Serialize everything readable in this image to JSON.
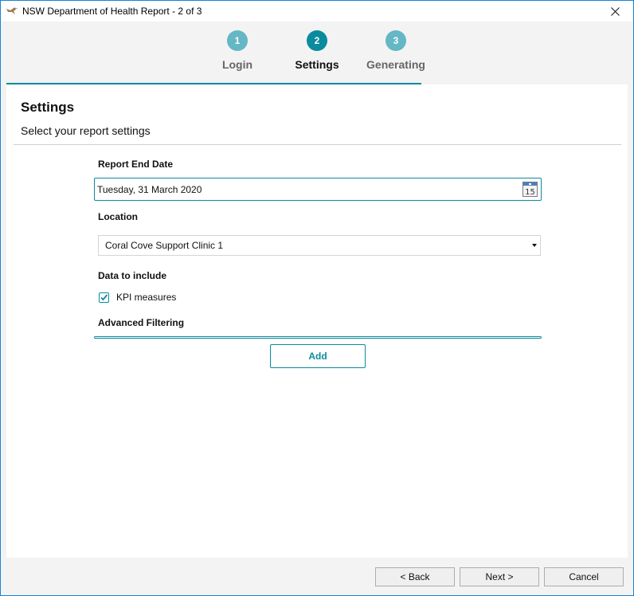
{
  "window": {
    "title": "NSW Department of Health Report - 2 of 3",
    "close_icon": "close-icon",
    "app_icon": "bird-logo-icon"
  },
  "stepper": {
    "steps": [
      {
        "number": "1",
        "label": "Login",
        "state": "done",
        "color": "#64b7c5"
      },
      {
        "number": "2",
        "label": "Settings",
        "state": "active",
        "color": "#0a8b9e"
      },
      {
        "number": "3",
        "label": "Generating",
        "state": "pending",
        "color": "#64b7c5"
      }
    ],
    "progress_color": "#0a8b9e"
  },
  "page": {
    "title": "Settings",
    "subtitle": "Select your report settings"
  },
  "form": {
    "report_end_date": {
      "label": "Report End Date",
      "value": "Tuesday, 31 March 2020",
      "icon": "calendar-icon",
      "icon_day": "15"
    },
    "location": {
      "label": "Location",
      "selected": "Coral Cove Support Clinic 1"
    },
    "data_to_include": {
      "label": "Data to include",
      "options": [
        {
          "label": "KPI measures",
          "checked": true
        }
      ]
    },
    "advanced_filtering": {
      "label": "Advanced Filtering",
      "add_label": "Add"
    }
  },
  "footer": {
    "back_label": "< Back",
    "next_label": "Next >",
    "cancel_label": "Cancel"
  },
  "colors": {
    "accent": "#0a8b9e",
    "accent_light": "#64b7c5",
    "window_border": "#1883d7"
  }
}
